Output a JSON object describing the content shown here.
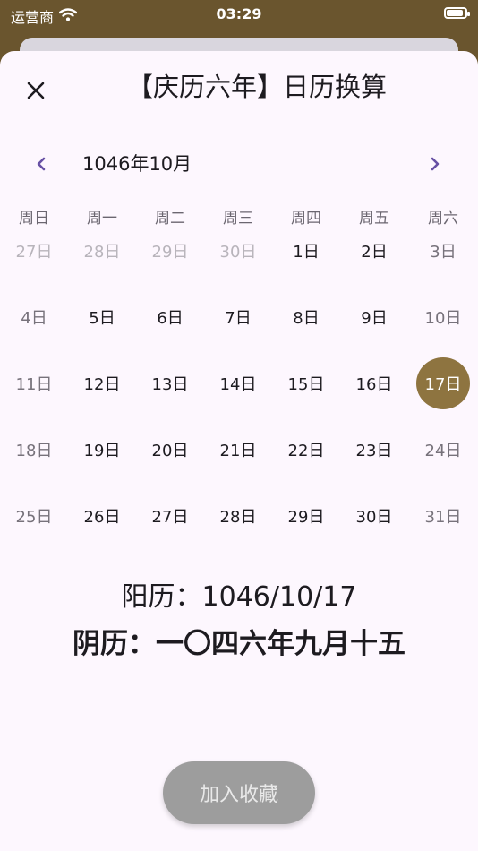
{
  "status_bar": {
    "carrier": "运营商",
    "time": "03:29",
    "wifi_icon": "wifi-icon",
    "battery_level": 1.0
  },
  "header": {
    "title": "【庆历六年】日历换算",
    "close_icon": "close-icon"
  },
  "calendar": {
    "month_label": "1046年10月",
    "prev_icon": "chevron-left-icon",
    "next_icon": "chevron-right-icon",
    "accent_color": "#6750a4",
    "selected_color": "#8e7440",
    "weekdays": [
      "周日",
      "周一",
      "周二",
      "周三",
      "周四",
      "周五",
      "周六"
    ],
    "weeks": [
      [
        {
          "label": "27日",
          "state": "muted"
        },
        {
          "label": "28日",
          "state": "muted"
        },
        {
          "label": "29日",
          "state": "muted"
        },
        {
          "label": "30日",
          "state": "muted"
        },
        {
          "label": "1日",
          "state": "normal"
        },
        {
          "label": "2日",
          "state": "normal"
        },
        {
          "label": "3日",
          "state": "weekend"
        }
      ],
      [
        {
          "label": "4日",
          "state": "weekend"
        },
        {
          "label": "5日",
          "state": "normal"
        },
        {
          "label": "6日",
          "state": "normal"
        },
        {
          "label": "7日",
          "state": "normal"
        },
        {
          "label": "8日",
          "state": "normal"
        },
        {
          "label": "9日",
          "state": "normal"
        },
        {
          "label": "10日",
          "state": "weekend"
        }
      ],
      [
        {
          "label": "11日",
          "state": "weekend"
        },
        {
          "label": "12日",
          "state": "normal"
        },
        {
          "label": "13日",
          "state": "normal"
        },
        {
          "label": "14日",
          "state": "normal"
        },
        {
          "label": "15日",
          "state": "normal"
        },
        {
          "label": "16日",
          "state": "normal"
        },
        {
          "label": "17日",
          "state": "selected"
        }
      ],
      [
        {
          "label": "18日",
          "state": "weekend"
        },
        {
          "label": "19日",
          "state": "normal"
        },
        {
          "label": "20日",
          "state": "normal"
        },
        {
          "label": "21日",
          "state": "normal"
        },
        {
          "label": "22日",
          "state": "normal"
        },
        {
          "label": "23日",
          "state": "normal"
        },
        {
          "label": "24日",
          "state": "weekend"
        }
      ],
      [
        {
          "label": "25日",
          "state": "weekend"
        },
        {
          "label": "26日",
          "state": "normal"
        },
        {
          "label": "27日",
          "state": "normal"
        },
        {
          "label": "28日",
          "state": "normal"
        },
        {
          "label": "29日",
          "state": "normal"
        },
        {
          "label": "30日",
          "state": "normal"
        },
        {
          "label": "31日",
          "state": "weekend"
        }
      ]
    ]
  },
  "result": {
    "solar": "阳历：1046/10/17",
    "lunar": "阴历：一〇四六年九月十五"
  },
  "actions": {
    "favorite_label": "加入收藏"
  }
}
